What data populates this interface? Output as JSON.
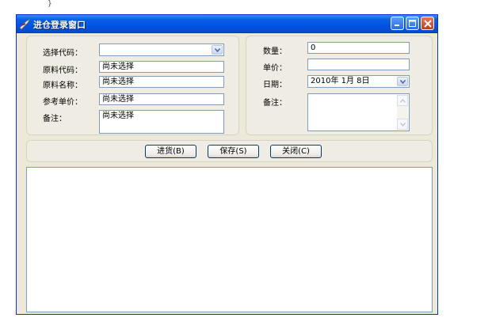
{
  "stray_mark": "}",
  "window": {
    "title": "进仓登录窗口"
  },
  "left_group": {
    "code_label": "选择代码：",
    "code_value": "",
    "material_code_label": "原料代码：",
    "material_code_value": "尚未选择",
    "material_name_label": "原料名称：",
    "material_name_value": "尚未选择",
    "ref_price_label": "参考单价：",
    "ref_price_value": "尚未选择",
    "note_label": "备注：",
    "note_value": "尚未选择"
  },
  "right_group": {
    "qty_label": "数量：",
    "qty_value": "0",
    "price_label": "单价：",
    "price_value": "",
    "date_label": "日期：",
    "date_value": "2010年 1月 8日",
    "remark_label": "备注：",
    "remark_value": ""
  },
  "buttons": {
    "stock_in": "进货(B)",
    "save": "保存(S)",
    "close": "关闭(C)"
  },
  "colors": {
    "title_bar": "#0054E3",
    "close_button": "#C73A1C",
    "window_bg": "#ECE9D8"
  }
}
